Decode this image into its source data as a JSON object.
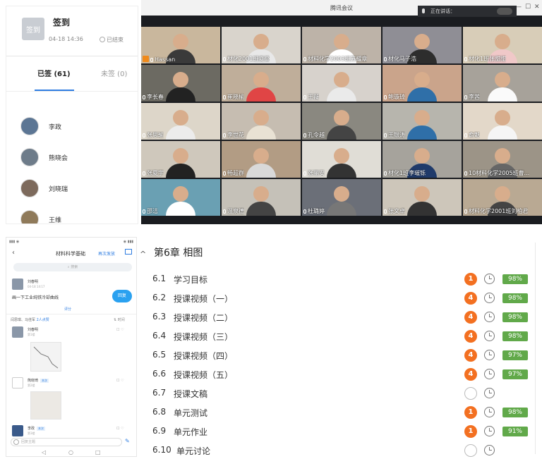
{
  "checkin": {
    "badge": "签到",
    "title": "签到",
    "time": "04-18 14:36",
    "state": "已结束",
    "tab_signed": "已签 (61)",
    "tab_unsigned": "未签 (0)",
    "members": [
      {
        "name": "李政"
      },
      {
        "name": "熊晓会"
      },
      {
        "name": "刘晓瑞"
      },
      {
        "name": "王维"
      }
    ]
  },
  "meeting": {
    "title": "腾讯会议",
    "speaking": "正在讲话：",
    "participants": [
      {
        "name": "Hassan"
      },
      {
        "name": "材化2001班夏豪"
      },
      {
        "name": "材料化学2003班苏耀章"
      },
      {
        "name": "材化马子浩"
      },
      {
        "name": "材化1班张甜甜"
      },
      {
        "name": "李长春"
      },
      {
        "name": "崔晓榆"
      },
      {
        "name": "王薇"
      },
      {
        "name": "鲍璇琦"
      },
      {
        "name": "李茜"
      },
      {
        "name": "张思瑜"
      },
      {
        "name": "李世花"
      },
      {
        "name": "孔令越"
      },
      {
        "name": "王银涛"
      },
      {
        "name": "俞魁"
      },
      {
        "name": "张夏宇"
      },
      {
        "name": "畅超群"
      },
      {
        "name": "张丽安"
      },
      {
        "name": "材化1班李璀铄"
      },
      {
        "name": "10材料化学2005班曹..."
      },
      {
        "name": "邵洁"
      },
      {
        "name": "温泉德"
      },
      {
        "name": "杜璐婷"
      },
      {
        "name": "张文卓"
      },
      {
        "name": "材料化学2001班刘柏君"
      }
    ],
    "colors": {
      "host": "#f08a1b"
    }
  },
  "phone": {
    "title": "材料科学基础",
    "link": "再次发放",
    "search": "搜索",
    "post_author": "刘春明",
    "post_meta": "04-18 14:17",
    "post_text": "画一下工业纯铁冷却曲线",
    "reply_label": "回复",
    "rate_label": "评分",
    "likes": "闫思琪、马佳军",
    "likes_count": "2人点赞",
    "sort_label": "时间",
    "comments": [
      {
        "name": "刘春明",
        "meta": "第1楼"
      },
      {
        "name": "熊晓琦",
        "meta": "第2楼"
      },
      {
        "name": "李政",
        "meta": "第3楼"
      }
    ],
    "tag": "本次",
    "input_placeholder": "回复主题"
  },
  "chapter": {
    "title": "第6章 相图",
    "items": [
      {
        "num": "6.1",
        "label": "学习目标",
        "tasks": "1",
        "progress": "98%"
      },
      {
        "num": "6.2",
        "label": "授课视频（一）",
        "tasks": "4",
        "progress": "98%"
      },
      {
        "num": "6.3",
        "label": "授课视频（二）",
        "tasks": "4",
        "progress": "98%"
      },
      {
        "num": "6.4",
        "label": "授课视频（三）",
        "tasks": "4",
        "progress": "98%"
      },
      {
        "num": "6.5",
        "label": "授课视频（四）",
        "tasks": "4",
        "progress": "97%"
      },
      {
        "num": "6.6",
        "label": "授课视频（五）",
        "tasks": "4",
        "progress": "97%"
      },
      {
        "num": "6.7",
        "label": "授课文稿",
        "tasks": "",
        "progress": ""
      },
      {
        "num": "6.8",
        "label": "单元测试",
        "tasks": "1",
        "progress": "98%"
      },
      {
        "num": "6.9",
        "label": "单元作业",
        "tasks": "1",
        "progress": "91%"
      },
      {
        "num": "6.10",
        "label": "单元讨论",
        "tasks": "",
        "progress": ""
      }
    ],
    "colors": {
      "task": "#f37021",
      "progress": "#61a94a"
    }
  }
}
